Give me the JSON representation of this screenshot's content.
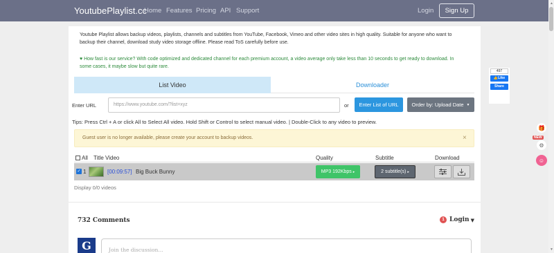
{
  "navbar": {
    "brand": "YoutubePlaylist.cc",
    "links": [
      "Home",
      "Features",
      "Pricing",
      "API",
      "Support"
    ],
    "login": "Login",
    "signup": "Sign Up"
  },
  "intro": {
    "description": "Youtube Playlist allows backup videos, playlists, channels and subtitles from YouTube, Facebook, Vimeo and other video sites in high quality. Suitable for anyone who want to backup their channel, download study video storage offline. Please read ToS carefully before use.",
    "speed_heart": "♥",
    "speed_text": "How fast is our service? With code optimized and dedicated channel for each premium account, a video average only take less than 10 seconds to get ready to download. In some cases, it maybe slow but quite rare."
  },
  "tabs": {
    "list_video": "List Video",
    "downloader": "Downloader"
  },
  "form": {
    "enter_url_label": "Enter URL",
    "url_placeholder": "https://www.youtube.com/?list=xyz",
    "or": "or",
    "enter_list_button": "Enter List of URL",
    "order_button": "Order by: Upload Date"
  },
  "tips": "Tips: Press Ctrl + A or click All to Select All video. Hold Shift or Control to select manual video. | Double-Click to any video to preview.",
  "alert": {
    "message": "Guest user is no longer available, please create your account to backup videos.",
    "close": "×"
  },
  "table": {
    "headers": {
      "all": "All",
      "title": "Title Video",
      "quality": "Quality",
      "subtitle": "Subtitle",
      "download": "Download"
    },
    "rows": [
      {
        "index": "1",
        "duration": "[00:09:57]",
        "title": "Big Buck Bunny",
        "quality": "MP3 192Kbps",
        "subtitle": "2 subtitle(s)"
      }
    ]
  },
  "display_text": "Display 0/0 videos",
  "comments": {
    "count_label": "732 Comments",
    "notification_count": "1",
    "login": "Login",
    "avatar_letter": "G",
    "placeholder": "Join the discussion..."
  },
  "facebook": {
    "count": "497",
    "like": "Like",
    "share": "Share"
  },
  "side_badge": "NEW",
  "colors": {
    "navbar": "#6b7088",
    "tab_active": "#cfe8f8",
    "primary_button": "#2c96df",
    "quality_button": "#3fc468",
    "alert_bg": "#fdf6d6",
    "link": "#2a4fd8",
    "avatar": "#1a3b8a"
  },
  "icons": {
    "signup": "none",
    "heart": "heart-icon",
    "order_caret": "caret-down-icon",
    "alert_close": "close-icon",
    "row_checkbox": "checkbox-checked-icon",
    "quality_arrow": "chevron-right-icon",
    "subtitle_arrow": "chevron-right-icon",
    "download_settings": "sliders-icon",
    "download": "download-icon",
    "notification": "notification-badge",
    "login_caret": "caret-down-icon",
    "gift": "gift-icon",
    "settings": "gear-icon",
    "emoji": "smile-icon"
  }
}
